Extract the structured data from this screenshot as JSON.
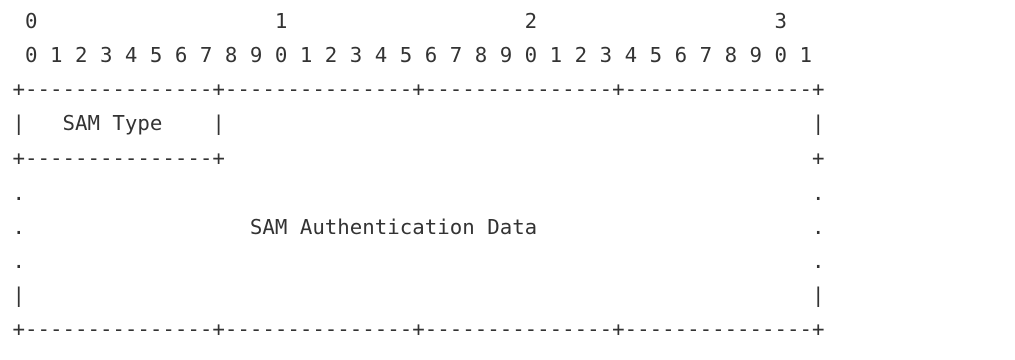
{
  "diagram": {
    "lines": [
      "  0                   1                   2                   3",
      "  0 1 2 3 4 5 6 7 8 9 0 1 2 3 4 5 6 7 8 9 0 1 2 3 4 5 6 7 8 9 0 1",
      " +---------------+---------------+---------------+---------------+",
      " |   SAM Type    |                                               |",
      " +---------------+                                               +",
      " .                                                               .",
      " .                  SAM Authentication Data                      .",
      " .                                                               .",
      " |                                                               |",
      " +---------------+---------------+---------------+---------------+"
    ]
  }
}
